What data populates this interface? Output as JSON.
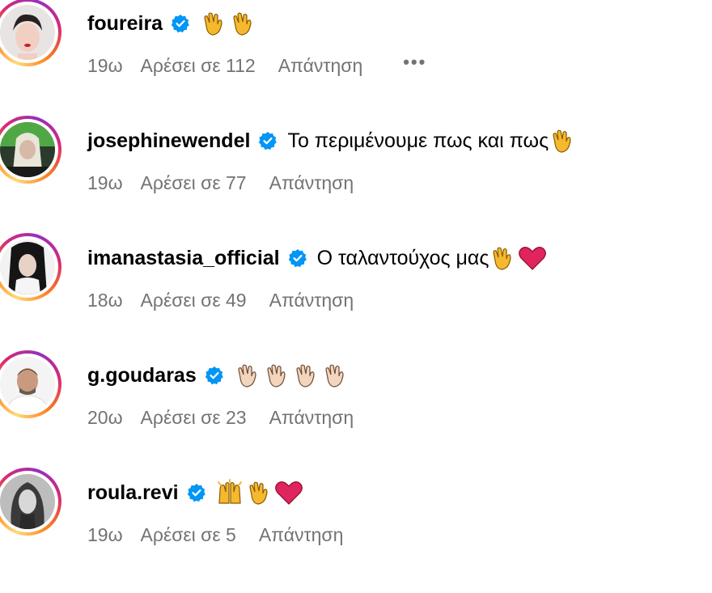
{
  "comments": [
    {
      "username": "foureira",
      "text": "",
      "emojis": [
        "clap",
        "clap"
      ],
      "time": "19ω",
      "likes": "Αρέσει σε 112",
      "reply": "Απάντηση",
      "more": "•••"
    },
    {
      "username": "josephinewendel",
      "text": "Το περιμένουμε πως και πως",
      "emojis": [
        "clap"
      ],
      "time": "19ω",
      "likes": "Αρέσει σε 77",
      "reply": "Απάντηση"
    },
    {
      "username": "imanastasia_official",
      "text": "Ο ταλαντούχος μας",
      "emojis": [
        "clap",
        "heart"
      ],
      "time": "18ω",
      "likes": "Αρέσει σε 49",
      "reply": "Απάντηση"
    },
    {
      "username": "g.goudaras",
      "text": "",
      "emojis": [
        "clap-light",
        "clap-light",
        "clap-light",
        "clap-light"
      ],
      "time": "20ω",
      "likes": "Αρέσει σε 23",
      "reply": "Απάντηση"
    },
    {
      "username": "roula.revi",
      "text": "",
      "emojis": [
        "raising-hands",
        "clap",
        "heart"
      ],
      "time": "19ω",
      "likes": "Αρέσει σε 5",
      "reply": "Απάντηση"
    }
  ],
  "colors": {
    "verified": "#0095f6",
    "secondary_text": "#737373",
    "heart": "#e0245e",
    "clap": "#f5b92e",
    "clap_light": "#f3d5bd"
  }
}
